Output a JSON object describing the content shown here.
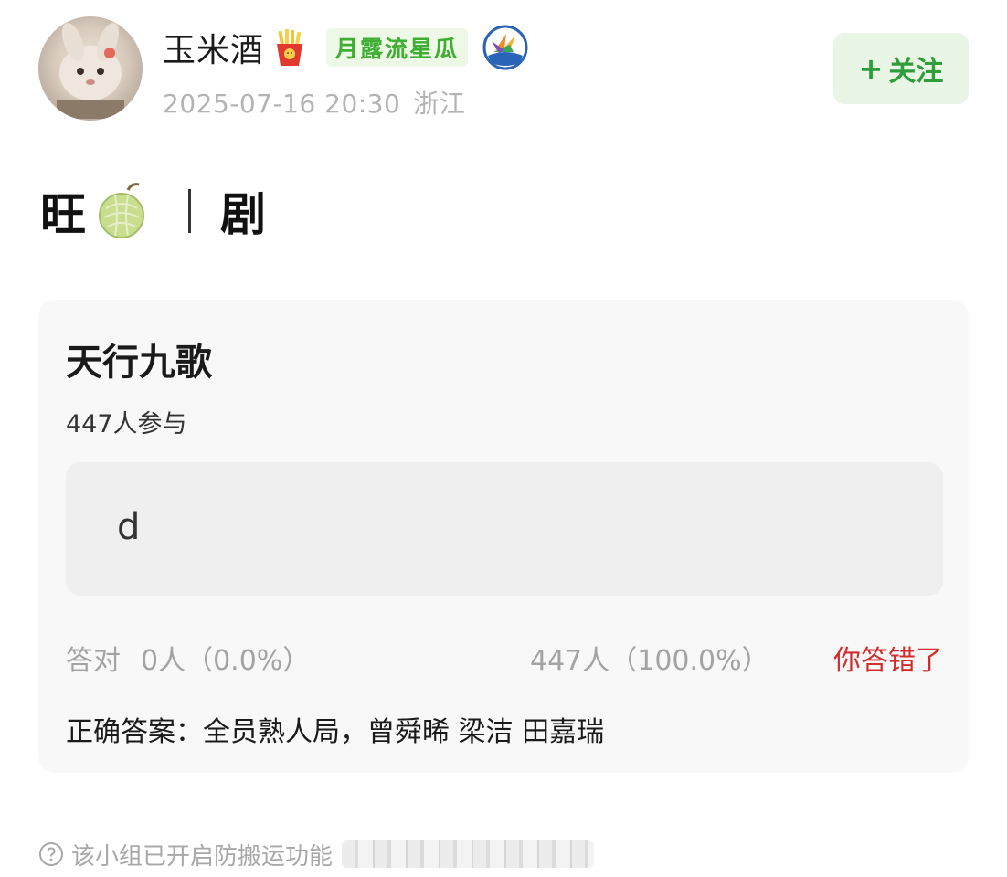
{
  "author": {
    "name": "玉米酒",
    "badge": "月露流星瓜",
    "timestamp": "2025-07-16 20:30",
    "location": "浙江"
  },
  "follow_button": {
    "plus": "+",
    "label": "关注"
  },
  "post": {
    "title_part1": "旺",
    "title_part2": "剧"
  },
  "quiz": {
    "title": "天行九歌",
    "participants": "447人参与",
    "option": "d",
    "correct_label": "答对",
    "correct_stat": "0人（0.0%）",
    "wrong_stat": "447人（100.0%）",
    "result": "你答错了",
    "answer": "正确答案：全员熟人局，曾舜晞 梁洁 田嘉瑞"
  },
  "footer": {
    "notice": "该小组已开启防搬运功能"
  },
  "icons": {
    "avatar": "plush-bunny-avatar",
    "badge_icon": "french-fries-icon",
    "level_icon": "bird-of-paradise-icon",
    "title_icon": "melon-icon",
    "footer_icon": "help-circle-icon"
  },
  "colors": {
    "accent_green": "#2f9e3a",
    "badge_green": "#3fae32",
    "wrong_red": "#d12d2d",
    "card_bg": "#f8f8f8"
  }
}
